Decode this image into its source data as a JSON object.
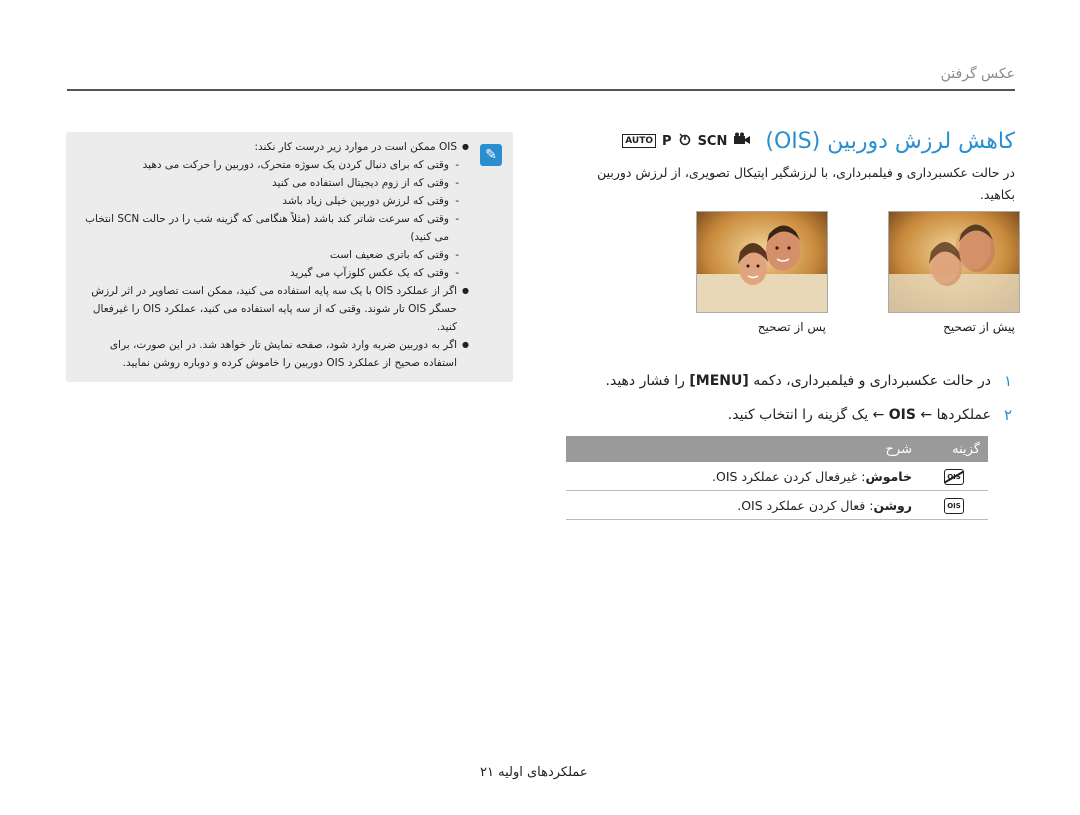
{
  "header": {
    "section": "عکس گرفتن"
  },
  "title": {
    "text": "کاهش لرزش دوربین (OIS)",
    "modes": [
      "AUTO",
      "P",
      "DUAL",
      "SCN",
      "MOVIE"
    ]
  },
  "intro": "در حالت عکسبرداری و فیلمبرداری، با لرزشگیر اپتیکال تصویری، از لرزش دوربین بکاهید.",
  "photos": {
    "before_caption": "پیش از تصحیح",
    "after_caption": "پس از تصحیح"
  },
  "steps": [
    {
      "num": "۱",
      "text_a": "در حالت عکسبرداری و فیلمبرداری، دکمه ",
      "key": "[MENU]",
      "text_b": " را فشار دهید."
    },
    {
      "num": "۲",
      "text_a": "عملکردها ← ",
      "key": "OIS",
      "text_b": " ← یک گزینه را انتخاب کنید."
    }
  ],
  "table": {
    "headers": {
      "option": "گزینه",
      "description": "شرح"
    },
    "rows": [
      {
        "icon": "ois-off-icon",
        "label": "خاموش",
        "desc": ": غیرفعال کردن عملکرد OIS."
      },
      {
        "icon": "ois-on-icon",
        "label": "روشن",
        "desc": ": فعال کردن عملکرد OIS."
      }
    ]
  },
  "notes": {
    "intro": "OIS ممکن است در موارد زیر درست کار نکند:",
    "subitems": [
      "وقتی که برای دنبال کردن یک سوژه متحرک، دوربین را حرکت می دهید",
      "وقتی که از زوم دیجیتال استفاده می کنید",
      "وقتی که لرزش دوربین خیلی زیاد باشد",
      "وقتی که سرعت شاتر کند باشد (مثلاً هنگامی که گزینه شب را در حالت SCN انتخاب می کنید)",
      "وقتی که باتری ضعیف است",
      "وقتی که یک عکس کلوزآپ می گیرید"
    ],
    "tripod": "اگر از عملکرد OIS با یک سه پایه استفاده می کنید، ممکن است تصاویر در اثر لرزش حسگر OIS تار شوند. وقتی که از سه پایه استفاده می کنید، عملکرد OIS را غیرفعال کنید.",
    "impact": "اگر به دوربین ضربه وارد شود، صفحه نمایش تار خواهد شد. در این صورت، برای استفاده صحیح از عملکرد OIS دوربین را خاموش کرده و دوباره روشن نمایید."
  },
  "footer": {
    "page": "عملکردهای اولیه ۲۱"
  }
}
